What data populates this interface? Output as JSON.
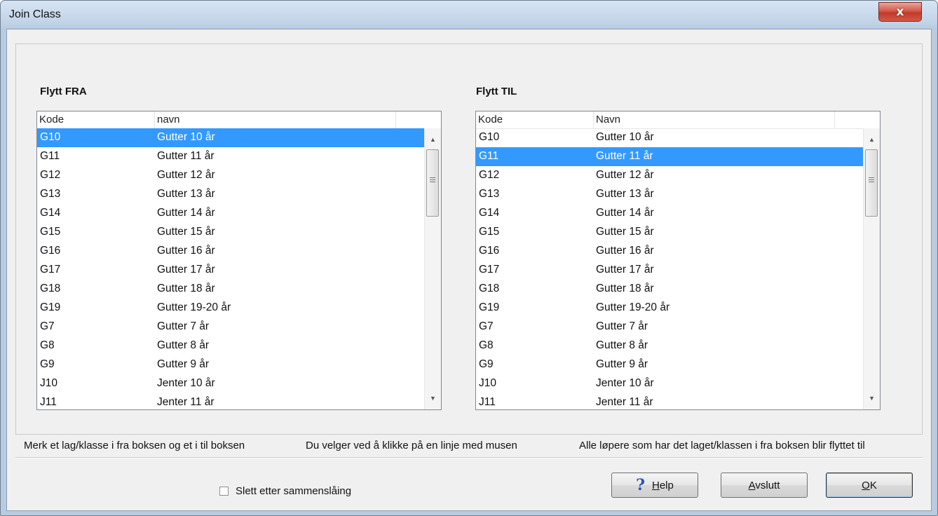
{
  "window": {
    "title": "Join Class",
    "close_label": "x"
  },
  "from_panel": {
    "title": "Flytt FRA",
    "headers": [
      "Kode",
      "navn"
    ],
    "selected_code": "G10",
    "rows": [
      {
        "code": "G10",
        "name": "Gutter 10 år"
      },
      {
        "code": "G11",
        "name": "Gutter 11 år"
      },
      {
        "code": "G12",
        "name": "Gutter 12 år"
      },
      {
        "code": "G13",
        "name": "Gutter 13 år"
      },
      {
        "code": "G14",
        "name": "Gutter 14 år"
      },
      {
        "code": "G15",
        "name": "Gutter 15 år"
      },
      {
        "code": "G16",
        "name": "Gutter 16 år"
      },
      {
        "code": "G17",
        "name": "Gutter 17 år"
      },
      {
        "code": "G18",
        "name": "Gutter 18 år"
      },
      {
        "code": "G19",
        "name": "Gutter 19-20 år"
      },
      {
        "code": "G7",
        "name": "Gutter 7 år"
      },
      {
        "code": "G8",
        "name": "Gutter 8 år"
      },
      {
        "code": "G9",
        "name": "Gutter 9 år"
      },
      {
        "code": "J10",
        "name": "Jenter 10 år"
      },
      {
        "code": "J11",
        "name": "Jenter 11 år"
      }
    ]
  },
  "to_panel": {
    "title": "Flytt TIL",
    "headers": [
      "Kode",
      "Navn"
    ],
    "selected_code": "G11",
    "rows": [
      {
        "code": "G10",
        "name": "Gutter 10 år"
      },
      {
        "code": "G11",
        "name": "Gutter 11 år"
      },
      {
        "code": "G12",
        "name": "Gutter 12 år"
      },
      {
        "code": "G13",
        "name": "Gutter 13 år"
      },
      {
        "code": "G14",
        "name": "Gutter 14 år"
      },
      {
        "code": "G15",
        "name": "Gutter 15 år"
      },
      {
        "code": "G16",
        "name": "Gutter 16 år"
      },
      {
        "code": "G17",
        "name": "Gutter 17 år"
      },
      {
        "code": "G18",
        "name": "Gutter 18 år"
      },
      {
        "code": "G19",
        "name": "Gutter 19-20 år"
      },
      {
        "code": "G7",
        "name": "Gutter 7 år"
      },
      {
        "code": "G8",
        "name": "Gutter 8 år"
      },
      {
        "code": "G9",
        "name": "Gutter 9 år"
      },
      {
        "code": "J10",
        "name": "Jenter 10 år"
      },
      {
        "code": "J11",
        "name": "Jenter 11 år"
      }
    ]
  },
  "instructions": {
    "line1": "Merk et lag/klasse i fra boksen og et i til boksen",
    "line2": "Du velger ved å klikke på en linje med musen",
    "line3": "Alle løpere som har det laget/klassen i fra boksen blir flyttet til"
  },
  "footer": {
    "checkbox_label": "Slett etter sammenslåing",
    "checkbox_checked": false,
    "help_label_first": "H",
    "help_label_rest": "elp",
    "exit_label_first": "A",
    "exit_label_rest": "vslutt",
    "ok_label_first": "O",
    "ok_label_rest": "K"
  },
  "icons": {
    "help": "question-mark-icon",
    "close": "close-icon",
    "scroll_up": "arrow-up-icon",
    "scroll_down": "arrow-down-icon"
  },
  "colors": {
    "selection": "#3399ff",
    "help_icon": "#2a54b8",
    "close_button": "#c2392b"
  }
}
